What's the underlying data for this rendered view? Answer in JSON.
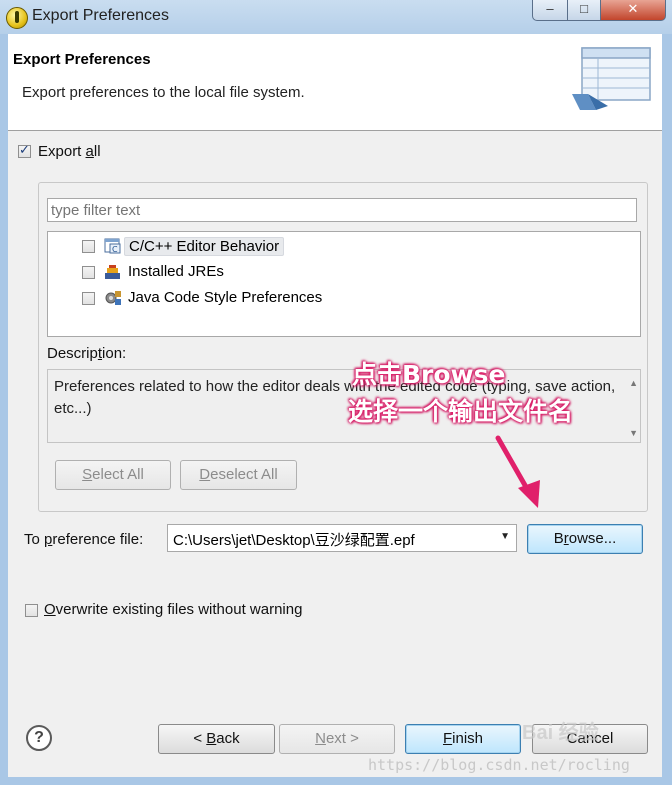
{
  "window": {
    "title": "Export Preferences",
    "controls": {
      "minimize": "‒",
      "maximize": "□",
      "close": "✕"
    }
  },
  "header": {
    "title": "Export Preferences",
    "subtitle": "Export preferences to the local file system."
  },
  "export_all": {
    "label_pre": "Export ",
    "label_u": "a",
    "label_post": "ll",
    "checked": true
  },
  "filter": {
    "placeholder": "type filter text",
    "value": ""
  },
  "tree": {
    "items": [
      {
        "label": "C/C++ Editor Behavior",
        "icon": "editor-behavior-icon",
        "checked": false,
        "selected": true
      },
      {
        "label": "Installed JREs",
        "icon": "jre-icon",
        "checked": false,
        "selected": false
      },
      {
        "label": "Java Code Style Preferences",
        "icon": "code-style-icon",
        "checked": false,
        "selected": false
      }
    ]
  },
  "description": {
    "label_pre": "Descrip",
    "label_u": "t",
    "label_post": "ion:",
    "text": "Preferences related to how the editor deals with the edited code (typing, save action, etc...)"
  },
  "buttons": {
    "select_all": {
      "pre": "",
      "u": "S",
      "post": "elect All"
    },
    "deselect_all": {
      "pre": "",
      "u": "D",
      "post": "eselect All"
    },
    "browse": {
      "pre": "B",
      "u": "r",
      "post": "owse..."
    },
    "back": {
      "pre": "< ",
      "u": "B",
      "post": "ack"
    },
    "next": {
      "pre": "",
      "u": "N",
      "post": "ext >"
    },
    "finish": {
      "pre": "",
      "u": "F",
      "post": "inish"
    },
    "cancel": {
      "label": "Cancel"
    }
  },
  "pref_file": {
    "label_pre": "To ",
    "label_u": "p",
    "label_post": "reference file:",
    "value": "C:\\Users\\jet\\Desktop\\豆沙绿配置.epf"
  },
  "overwrite": {
    "label_pre": "",
    "label_u": "O",
    "label_post": "verwrite existing files without warning",
    "checked": false
  },
  "annotation": {
    "line1": "点击Browse",
    "line2": "选择一个输出文件名",
    "color": "#e0206a"
  },
  "watermark": {
    "url": "https://blog.csdn.net/rocling",
    "baidu": "Bai 经验"
  }
}
